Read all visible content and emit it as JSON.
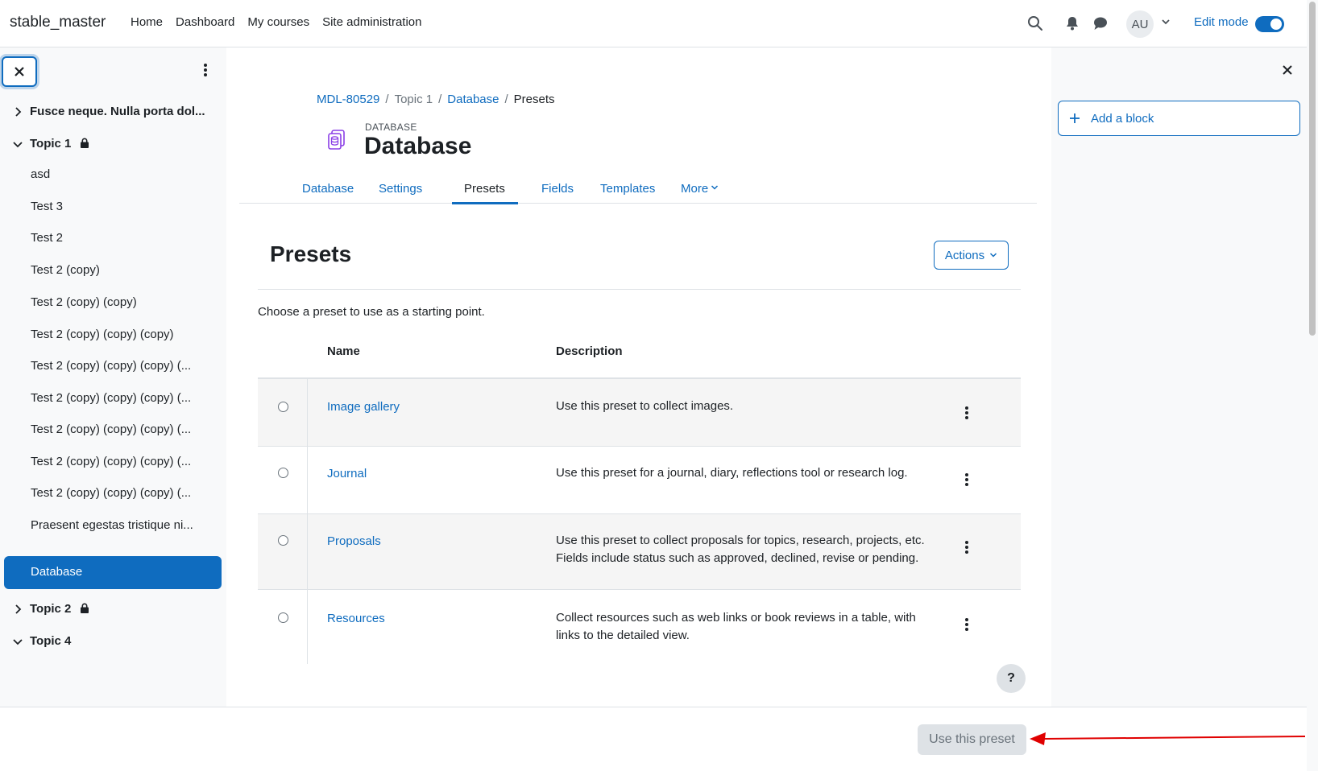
{
  "navbar": {
    "brand": "stable_master",
    "links": [
      "Home",
      "Dashboard",
      "My courses",
      "Site administration"
    ],
    "avatar_initials": "AU",
    "edit_mode_label": "Edit mode",
    "edit_mode_on": true,
    "icons": [
      "search-icon",
      "bell-icon",
      "message-icon",
      "chevron-down-icon"
    ]
  },
  "course_index": {
    "sections": [
      {
        "title": "Fusce neque. Nulla porta dol...",
        "expanded": false,
        "locked": false
      },
      {
        "title": "Topic 1",
        "expanded": true,
        "locked": true
      },
      {
        "title": "Topic 2",
        "expanded": false,
        "locked": true
      },
      {
        "title": "Topic 4",
        "expanded": true,
        "locked": false
      }
    ],
    "activities": [
      "asd",
      "Test 3",
      "Test 2",
      "Test 2 (copy)",
      "Test 2 (copy) (copy)",
      "Test 2 (copy) (copy) (copy)",
      "Test 2 (copy) (copy) (copy) (...",
      "Test 2 (copy) (copy) (copy) (...",
      "Test 2 (copy) (copy) (copy) (...",
      "Test 2 (copy) (copy) (copy) (...",
      "Test 2 (copy) (copy) (copy) (...",
      "Praesent egestas tristique ni...",
      "Database"
    ],
    "active_activity": "Database"
  },
  "breadcrumb": [
    "MDL-80529",
    "Topic 1",
    "Database",
    "Presets"
  ],
  "page": {
    "kicker": "DATABASE",
    "heading": "Database"
  },
  "secondary_nav": {
    "tabs": [
      "Database",
      "Settings",
      "Presets",
      "Fields",
      "Templates",
      "More"
    ],
    "active": "Presets"
  },
  "presets": {
    "title": "Presets",
    "actions_label": "Actions",
    "intro": "Choose a preset to use as a starting point.",
    "columns": [
      "Name",
      "Description"
    ],
    "rows": [
      {
        "name": "Image gallery",
        "description": "Use this preset to collect images."
      },
      {
        "name": "Journal",
        "description": "Use this preset for a journal, diary, reflections tool or research log."
      },
      {
        "name": "Proposals",
        "description": "Use this preset to collect proposals for topics, research, projects, etc. Fields include status such as approved, declined, revise or pending."
      },
      {
        "name": "Resources",
        "description": "Collect resources such as web links or book reviews in a table, with links to the detailed view."
      }
    ]
  },
  "blocks_drawer": {
    "add_block_label": "Add a block"
  },
  "help_label": "?",
  "footer": {
    "use_preset_label": "Use this preset",
    "use_preset_enabled": false
  },
  "colors": {
    "accent": "#0f6cbf",
    "drawer_bg": "#f8f9fa",
    "annotation_arrow": "#e00000"
  }
}
